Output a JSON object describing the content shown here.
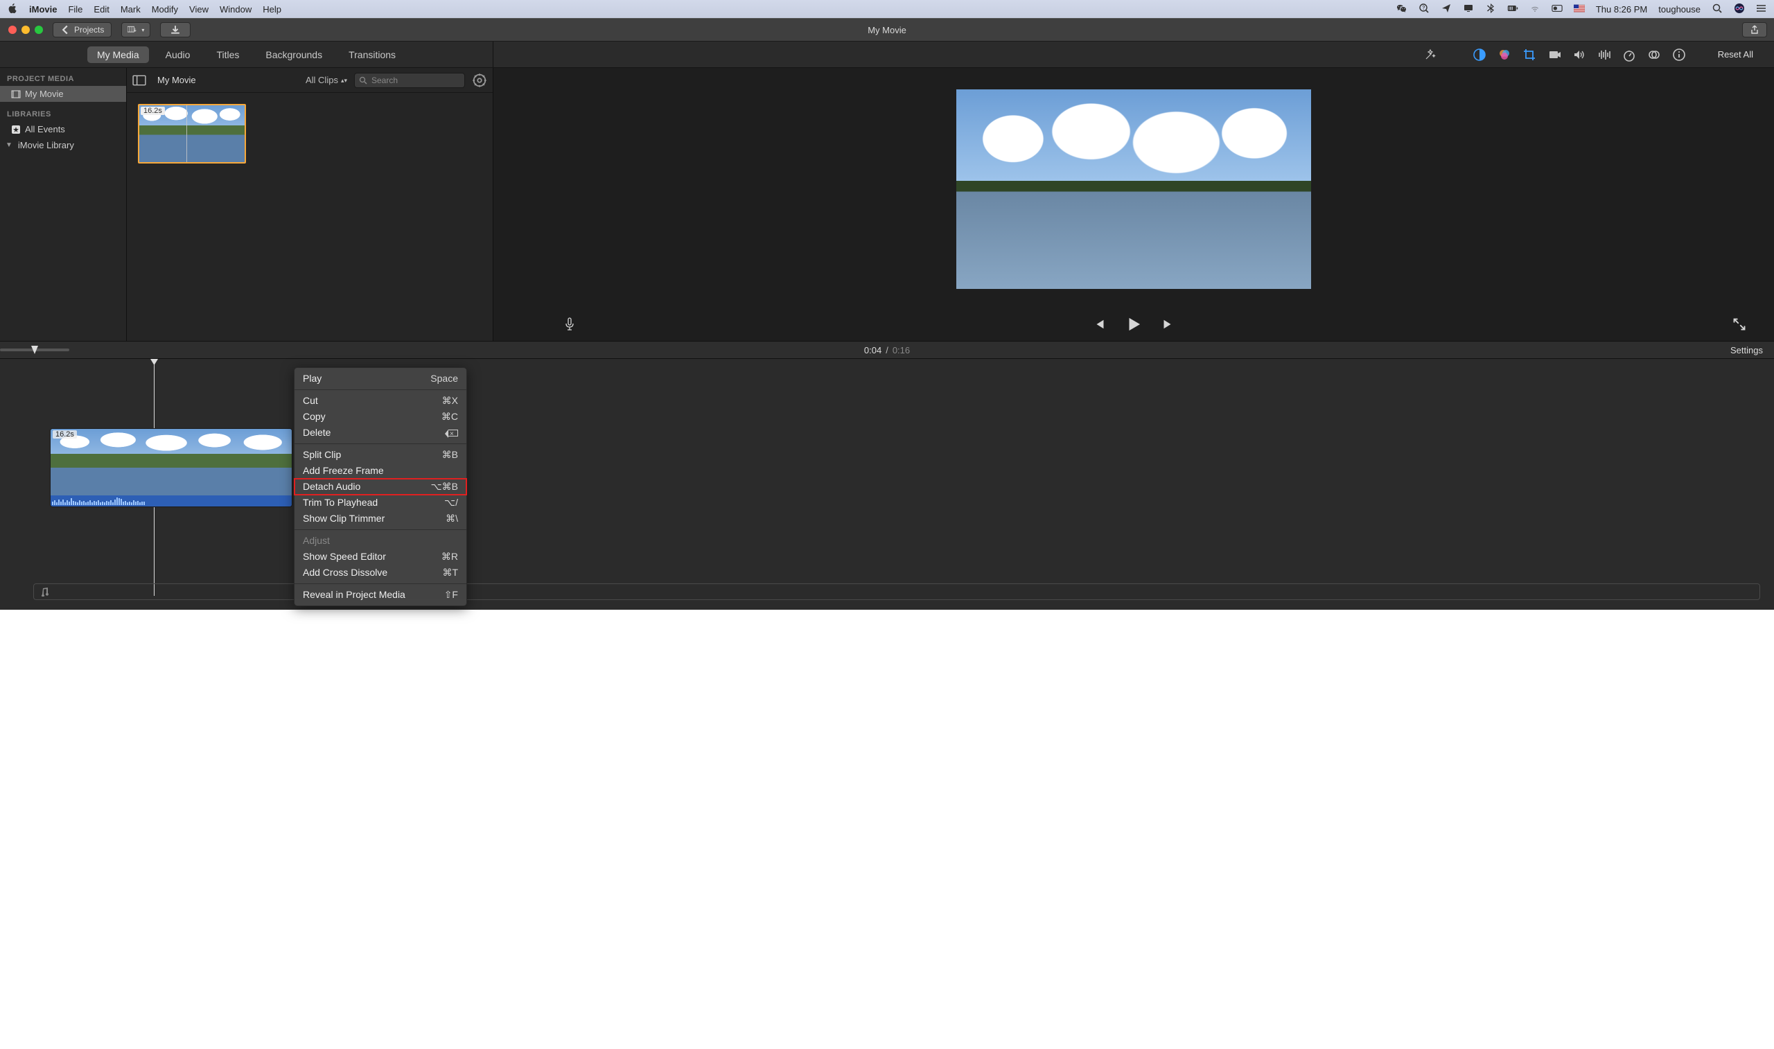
{
  "menubar": {
    "app": "iMovie",
    "items": [
      "File",
      "Edit",
      "Mark",
      "Modify",
      "View",
      "Window",
      "Help"
    ],
    "clock": "Thu 8:26 PM",
    "user": "toughouse"
  },
  "titlebar": {
    "back_label": "Projects",
    "title": "My Movie"
  },
  "tabs": {
    "items": [
      "My Media",
      "Audio",
      "Titles",
      "Backgrounds",
      "Transitions"
    ],
    "active_index": 0,
    "reset_all": "Reset All"
  },
  "sidebar": {
    "project_media_header": "PROJECT MEDIA",
    "project_item": "My Movie",
    "libraries_header": "LIBRARIES",
    "all_events": "All Events",
    "imovie_library": "iMovie Library"
  },
  "browser": {
    "title": "My Movie",
    "filter_label": "All Clips",
    "search_placeholder": "Search",
    "clip_duration": "16.2s"
  },
  "playback": {
    "current": "0:04",
    "separator": "/",
    "total": "0:16",
    "settings_label": "Settings"
  },
  "timeline": {
    "clip_duration": "16.2s"
  },
  "context_menu": {
    "items": [
      {
        "label": "Play",
        "shortcut": "Space",
        "group": 0
      },
      {
        "label": "Cut",
        "shortcut": "⌘X",
        "group": 1
      },
      {
        "label": "Copy",
        "shortcut": "⌘C",
        "group": 1
      },
      {
        "label": "Delete",
        "shortcut": "DEL",
        "group": 1
      },
      {
        "label": "Split Clip",
        "shortcut": "⌘B",
        "group": 2
      },
      {
        "label": "Add Freeze Frame",
        "shortcut": "",
        "group": 2
      },
      {
        "label": "Detach Audio",
        "shortcut": "⌥⌘B",
        "group": 2,
        "highlighted": true
      },
      {
        "label": "Trim To Playhead",
        "shortcut": "⌥/",
        "group": 2
      },
      {
        "label": "Show Clip Trimmer",
        "shortcut": "⌘\\",
        "group": 2
      },
      {
        "label": "Adjust",
        "shortcut": "",
        "group": 3,
        "disabled": true
      },
      {
        "label": "Show Speed Editor",
        "shortcut": "⌘R",
        "group": 3
      },
      {
        "label": "Add Cross Dissolve",
        "shortcut": "⌘T",
        "group": 3
      },
      {
        "label": "Reveal in Project Media",
        "shortcut": "⇧F",
        "group": 4
      }
    ]
  }
}
